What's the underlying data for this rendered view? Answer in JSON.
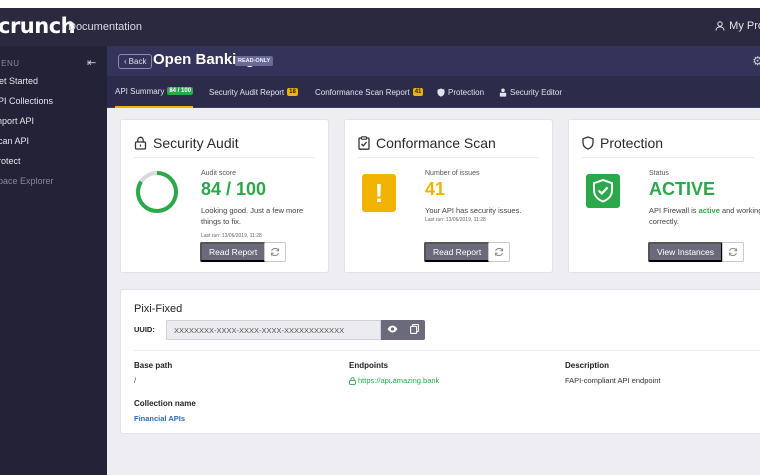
{
  "topbar": {
    "logo": "crunch",
    "documentation": "Documentation",
    "user": "My Pro"
  },
  "sidebar": {
    "menu_label": "MENU",
    "items": [
      {
        "label": "Get Started"
      },
      {
        "label": "API Collections"
      },
      {
        "label": "Import API"
      },
      {
        "label": "Scan API"
      },
      {
        "label": "Protect"
      },
      {
        "label": "Space Explorer"
      }
    ]
  },
  "header": {
    "back_label": "Back",
    "title": "Open Banking",
    "badge": "READ-ONLY"
  },
  "tabs": [
    {
      "label": "API Summary",
      "badge": "84 / 100"
    },
    {
      "label": "Security Audit Report",
      "badge": "18"
    },
    {
      "label": "Conformance Scan Report",
      "badge": "41"
    },
    {
      "label": "Protection"
    },
    {
      "label": "Security Editor"
    }
  ],
  "cards": {
    "audit": {
      "title": "Security Audit",
      "label": "Audit score",
      "value": "84 / 100",
      "score_fraction": 0.84,
      "desc": "Looking good. Just a few more things to fix.",
      "lastrun": "Last run: 13/06/2019, 11:28",
      "button": "Read Report"
    },
    "scan": {
      "title": "Conformance Scan",
      "label": "Number of issues",
      "value": "41",
      "desc": "Your API has security issues.",
      "lastrun": "Last run: 13/06/2019, 11:28",
      "button": "Read Report"
    },
    "protection": {
      "title": "Protection",
      "label": "Status",
      "value": "ACTIVE",
      "desc_pre": "API Firewall is ",
      "desc_bold": "active",
      "desc_post": " and working correctly.",
      "button": "View Instances"
    }
  },
  "api": {
    "name": "Pixi-Fixed",
    "uuid_label": "UUID:",
    "uuid": "XXXXXXXX-XXXX-XXXX-XXXX-XXXXXXXXXXXX",
    "base_path_label": "Base path",
    "base_path": "/",
    "endpoints_label": "Endpoints",
    "endpoint": "https://api.amazing.bank",
    "description_label": "Description",
    "description": "FAPI-compliant API endpoint",
    "collection_label": "Collection name",
    "collection": "Financial APIs"
  },
  "colors": {
    "accent_green": "#2aa84a",
    "accent_yellow": "#f0b400",
    "nav_dark": "#2a2940"
  }
}
